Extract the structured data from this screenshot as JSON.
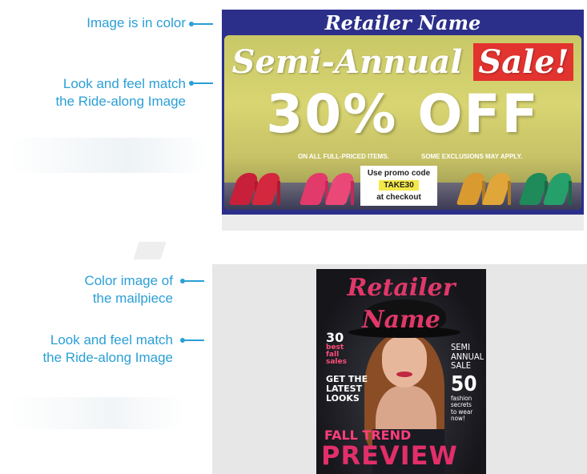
{
  "callouts": {
    "c1": "Image is in color",
    "c2_line1": "Look and feel match",
    "c2_line2": "the Ride-along Image",
    "c3_line1": "Color image of",
    "c3_line2": "the mailpiece",
    "c4_line1": "Look and feel match",
    "c4_line2": "the Ride-along Image"
  },
  "colors": {
    "callout": "#2a9fd6",
    "email_bg": "#2b2f8a",
    "sale_red": "#e2332f",
    "promo_yellow": "#f4e84a",
    "mag_pink": "#e0386a"
  },
  "email": {
    "retailer": "Retailer Name",
    "headline_main": "Semi-Annual ",
    "headline_sale": "Sale!",
    "discount": "30% OFF",
    "fine_left": "ON ALL FULL-PRICED ITEMS.",
    "fine_right": "SOME EXCLUSIONS MAY APPLY.",
    "promo_intro": "Use promo code",
    "promo_code": "TAKE30",
    "promo_outro": "at checkout"
  },
  "magazine": {
    "retailer": "Retailer Name",
    "left_num": "30",
    "left_small1": "best",
    "left_small2": "fall",
    "left_small3": "sales",
    "latest1": "GET THE",
    "latest2": "LATEST",
    "latest3": "LOOKS",
    "right1": "SEMI",
    "right2": "ANNUAL",
    "right3": "SALE",
    "right_num": "50",
    "right_s1": "fashion",
    "right_s2": "secrets",
    "right_s3": "to wear",
    "right_s4": "now!",
    "fall_trend": "FALL TREND",
    "preview": "PREVIEW"
  }
}
